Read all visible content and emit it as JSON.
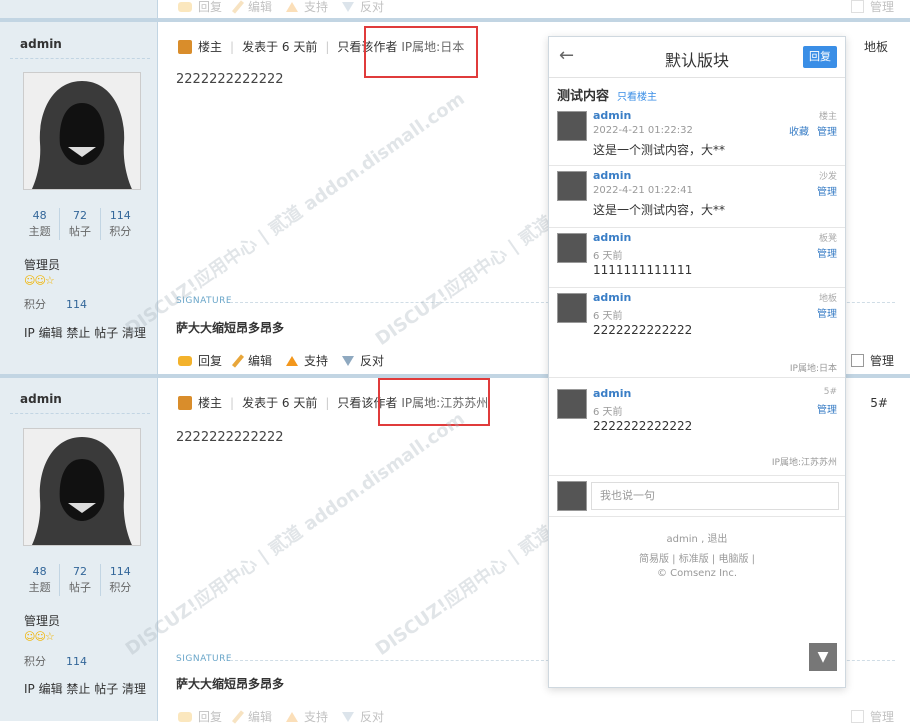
{
  "top_bar": {
    "reply": "回复",
    "edit": "编辑",
    "support": "支持",
    "oppose": "反对",
    "manage": "管理"
  },
  "posts": [
    {
      "author": "admin",
      "stats": [
        {
          "num": "48",
          "label": "主题"
        },
        {
          "num": "72",
          "label": "帖子"
        },
        {
          "num": "114",
          "label": "积分"
        }
      ],
      "rank": "管理员",
      "points_label": "积分",
      "points_value": "114",
      "mod_links": "IP 编辑 禁止 帖子 清理",
      "floor_tag": "楼主",
      "posted": "发表于 6 天前",
      "only_author": "只看该作者",
      "ip": "IP属地:日本",
      "content": "2222222222222",
      "signature_label": "SIGNATURE",
      "signature": "萨大大缩短昂多昂多",
      "reply": "回复",
      "edit": "编辑",
      "support": "支持",
      "oppose": "反对",
      "manage": "管理",
      "floor_label": "地板"
    },
    {
      "author": "admin",
      "stats": [
        {
          "num": "48",
          "label": "主题"
        },
        {
          "num": "72",
          "label": "帖子"
        },
        {
          "num": "114",
          "label": "积分"
        }
      ],
      "rank": "管理员",
      "points_label": "积分",
      "points_value": "114",
      "mod_links": "IP 编辑 禁止 帖子 清理",
      "floor_tag": "楼主",
      "posted": "发表于 6 天前",
      "only_author": "只看该作者",
      "ip": "IP属地:江苏苏州",
      "content": "2222222222222",
      "signature_label": "SIGNATURE",
      "signature": "萨大大缩短昂多昂多",
      "floor_label": "5#"
    }
  ],
  "bottom_bar": {
    "reply": "回复",
    "edit": "编辑",
    "support": "支持",
    "oppose": "反对",
    "manage": "管理"
  },
  "mobile": {
    "back": "←",
    "title": "默认版块",
    "reply_button": "回复",
    "thread_title": "测试内容",
    "only_host": "只看楼主",
    "posts": [
      {
        "name": "admin",
        "time": "2022-4-21 01:22:32",
        "text": "这是一个测试内容，大**",
        "floor": "楼主",
        "actions": [
          "收藏",
          "管理"
        ],
        "ip": ""
      },
      {
        "name": "admin",
        "time": "2022-4-21 01:22:41",
        "text": "这是一个测试内容，大**",
        "floor": "沙发",
        "actions": [
          "管理"
        ],
        "ip": ""
      },
      {
        "name": "admin",
        "time": "6 天前",
        "text": "1111111111111",
        "floor": "板凳",
        "actions": [
          "管理"
        ],
        "ip": ""
      },
      {
        "name": "admin",
        "time": "6 天前",
        "text": "2222222222222",
        "floor": "地板",
        "actions": [
          "管理"
        ],
        "ip": "IP属地:日本"
      },
      {
        "name": "admin",
        "time": "6 天前",
        "text": "2222222222222",
        "floor": "5#",
        "actions": [
          "管理"
        ],
        "ip": "IP属地:江苏苏州"
      }
    ],
    "input_placeholder": "我也说一句",
    "footer_user": "admin",
    "footer_logout": "退出",
    "footer_links": [
      "简易版",
      "标准版",
      "电脑版"
    ],
    "footer_copy": "© Comsenz Inc.",
    "scroll_icon": "▼"
  },
  "watermark": "DISCUZ!应用中心 | 贰道 addon.dismall.com"
}
